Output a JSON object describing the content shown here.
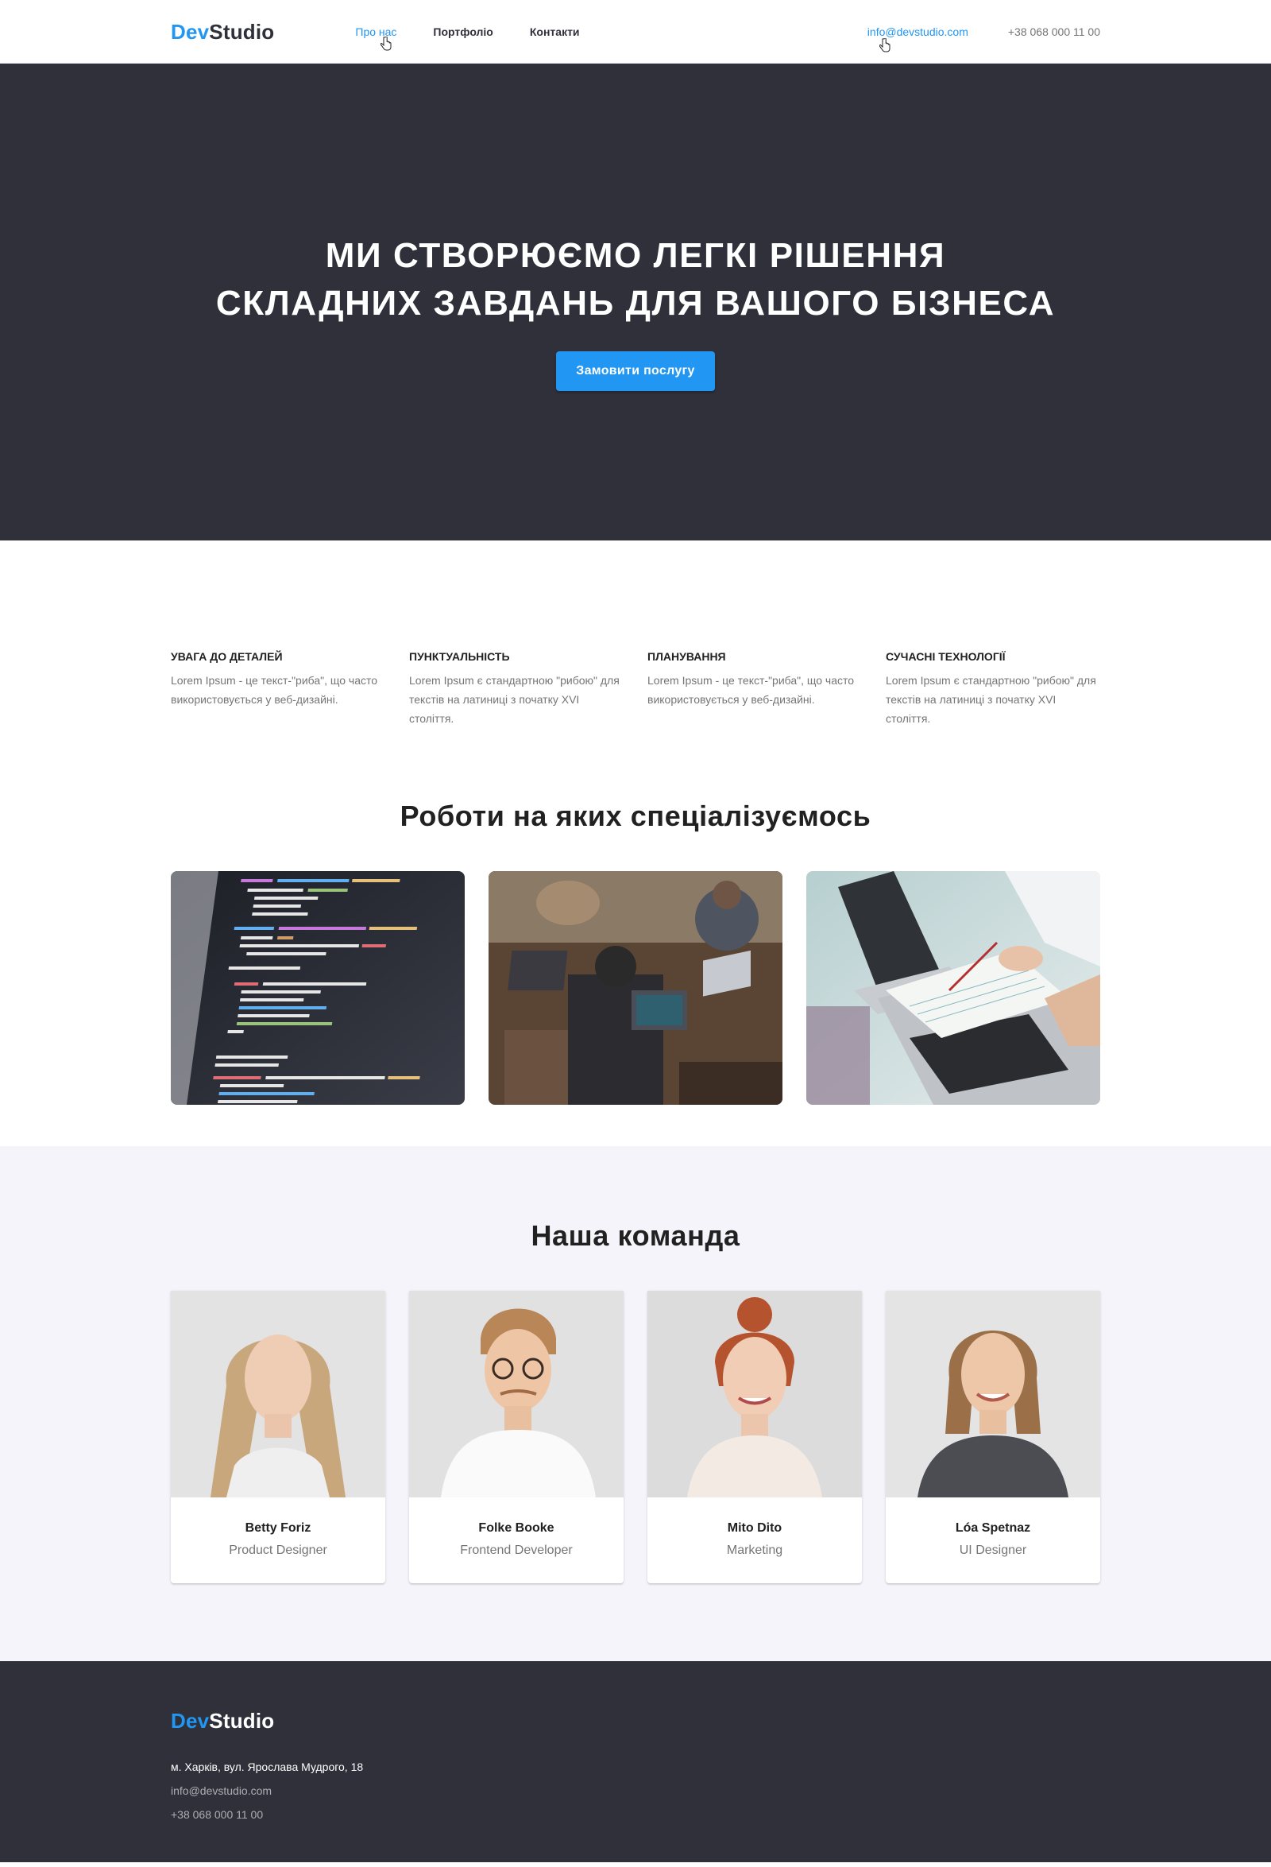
{
  "header": {
    "logo_accent": "Dev",
    "logo_main": "Studio",
    "nav": [
      {
        "label": "Про нас"
      },
      {
        "label": "Портфоліо"
      },
      {
        "label": "Контакти"
      }
    ],
    "email": "info@devstudio.com",
    "phone": "+38 068 000 11 00"
  },
  "hero": {
    "title_line1": "Ми створюємо легкі рішення",
    "title_line2": "складних завдань для вашого бізнеса",
    "button_label": "Замовити послугу"
  },
  "features": [
    {
      "title": "Увага до деталей",
      "text": "Lorem Ipsum - це текст-\"риба\", що часто використовується у веб-дизайні."
    },
    {
      "title": "Пунктуальність",
      "text": "Lorem Ipsum є стандартною \"рибою\" для текстів на латиниці з початку XVI століття."
    },
    {
      "title": "Планування",
      "text": "Lorem Ipsum - це текст-\"риба\", що часто використовується у веб-дизайні."
    },
    {
      "title": "Сучасні технології",
      "text": "Lorem Ipsum є стандартною \"рибою\" для текстів на латиниці з початку XVI століття."
    }
  ],
  "work": {
    "title": "Роботи на яких спеціалізуємось"
  },
  "team": {
    "title": "Наша команда",
    "members": [
      {
        "name": "Betty Foriz",
        "role": "Product Designer"
      },
      {
        "name": "Folke Booke",
        "role": "Frontend Developer"
      },
      {
        "name": "Mito Dito",
        "role": "Marketing"
      },
      {
        "name": "Lóa Spetnaz",
        "role": "UI Designer"
      }
    ]
  },
  "footer": {
    "logo_accent": "Dev",
    "logo_main": "Studio",
    "address": "м. Харків, вул. Ярослава Мудрого, 18",
    "email": "info@devstudio.com",
    "phone": "+38 068 000 11 00"
  },
  "colors": {
    "accent": "#2196f3",
    "dark": "#2f303a",
    "team_bg": "#f5f4fa"
  }
}
